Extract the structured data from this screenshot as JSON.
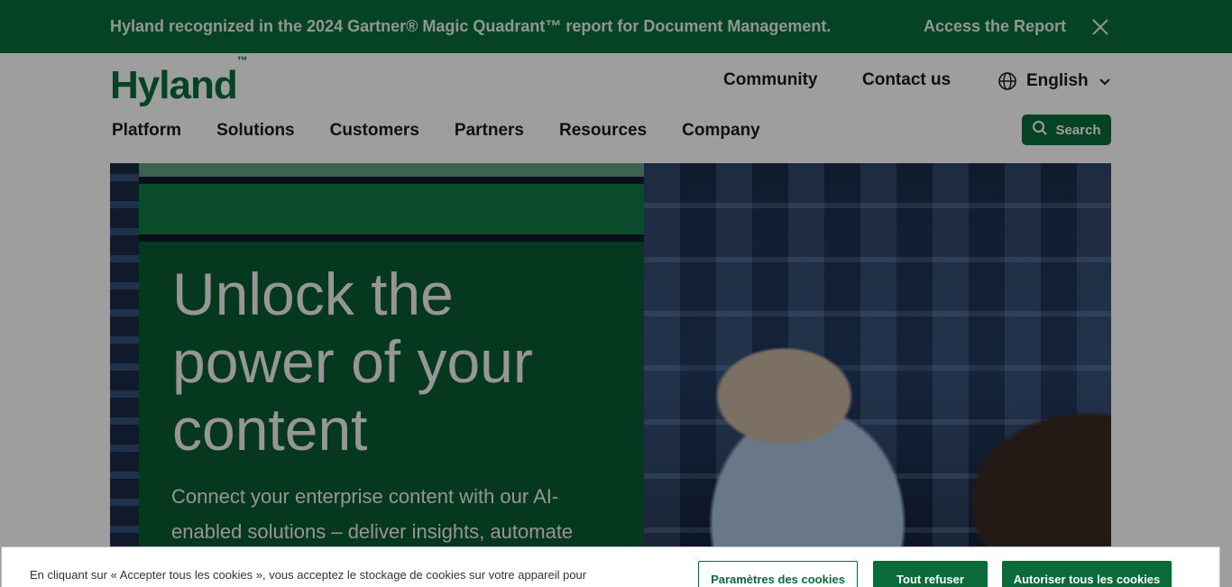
{
  "announcement": {
    "message": "Hyland recognized in the 2024 Gartner® Magic Quadrant™ report for Document Management.",
    "cta": "Access the Report",
    "close_icon": "close-icon"
  },
  "header": {
    "logo_text": "Hyland",
    "logo_mark": "™",
    "utility": {
      "community": "Community",
      "contact": "Contact us",
      "language": "English"
    },
    "nav": [
      "Platform",
      "Solutions",
      "Customers",
      "Partners",
      "Resources",
      "Company"
    ],
    "search_label": "Search"
  },
  "hero": {
    "headline": "Unlock the power of your content",
    "subtext": "Connect your enterprise content with our AI-enabled solutions – deliver insights, automate"
  },
  "cookie": {
    "text": "En cliquant sur « Accepter tous les cookies », vous acceptez le stockage de cookies sur votre appareil pour",
    "settings_label": "Paramètres des cookies",
    "refuse_label": "Tout refuser",
    "allow_label": "Autoriser tous les cookies"
  },
  "colors": {
    "brand_green": "#0a6b3a",
    "panel_green": "#0b5a33"
  }
}
